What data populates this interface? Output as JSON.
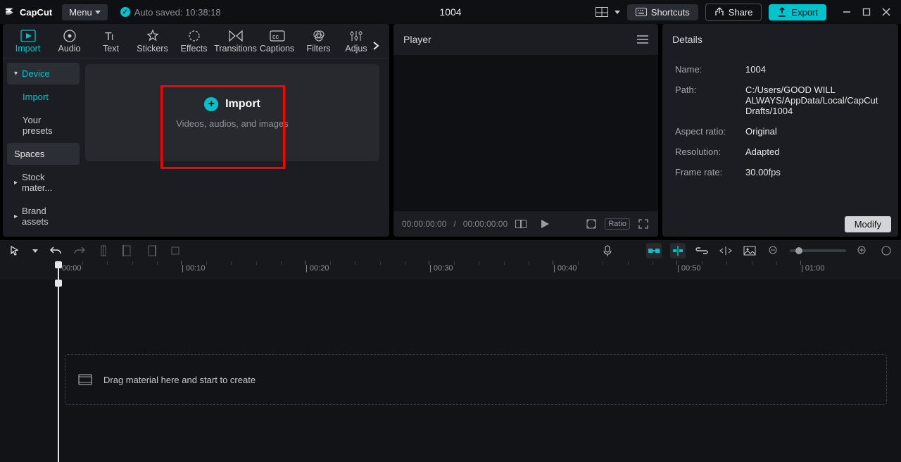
{
  "titlebar": {
    "app_name": "CapCut",
    "menu_label": "Menu",
    "autosaved_label": "Auto saved: 10:38:18",
    "project_title": "1004",
    "shortcuts_label": "Shortcuts",
    "share_label": "Share",
    "export_label": "Export"
  },
  "media_tabs": {
    "items": [
      {
        "label": "Import"
      },
      {
        "label": "Audio"
      },
      {
        "label": "Text"
      },
      {
        "label": "Stickers"
      },
      {
        "label": "Effects"
      },
      {
        "label": "Transitions"
      },
      {
        "label": "Captions"
      },
      {
        "label": "Filters"
      },
      {
        "label": "Adjus"
      }
    ]
  },
  "media_sidebar": {
    "device": "Device",
    "import": "Import",
    "presets": "Your presets",
    "spaces": "Spaces",
    "stock": "Stock mater...",
    "brand": "Brand assets"
  },
  "dropzone": {
    "title": "Import",
    "subtitle": "Videos, audios, and images"
  },
  "player": {
    "title": "Player",
    "time_current": "00:00:00:00",
    "time_sep": " / ",
    "time_total": "00:00:00:00",
    "ratio_label": "Ratio"
  },
  "details": {
    "title": "Details",
    "name_k": "Name:",
    "name_v": "1004",
    "path_k": "Path:",
    "path_v": "C:/Users/GOOD WILL ALWAYS/AppData/Local/CapCut Drafts/1004",
    "aspect_k": "Aspect ratio:",
    "aspect_v": "Original",
    "res_k": "Resolution:",
    "res_v": "Adapted",
    "fps_k": "Frame rate:",
    "fps_v": "30.00fps",
    "modify_label": "Modify"
  },
  "timeline": {
    "ticks": [
      "00:00",
      "00:10",
      "00:20",
      "00:30",
      "00:40",
      "00:50",
      "01:00"
    ],
    "drop_hint": "Drag material here and start to create"
  }
}
